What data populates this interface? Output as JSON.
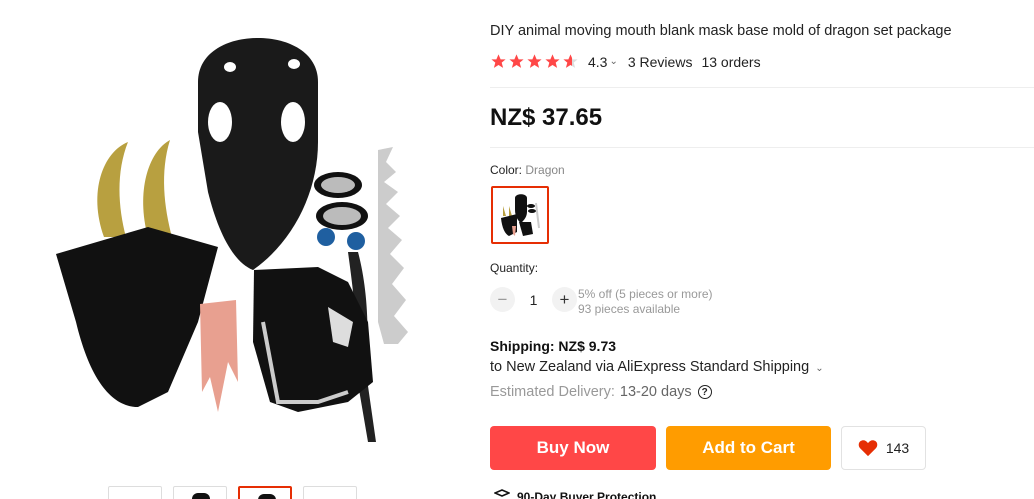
{
  "product": {
    "title": "DIY animal moving mouth blank mask base mold of dragon set package",
    "rating": "4.3",
    "reviews": "3 Reviews",
    "orders": "13 orders",
    "price": "NZ$ 37.65",
    "main_image_icon": "dragon-mask-kit-image"
  },
  "color": {
    "label": "Color:",
    "value": "Dragon"
  },
  "quantity": {
    "label": "Quantity:",
    "minus": "−",
    "value": "1",
    "plus": "+",
    "discount_note": "5% off (5 pieces or more)",
    "available_note": "93 pieces available"
  },
  "shipping": {
    "title": "Shipping: NZ$ 9.73",
    "via": "to New Zealand via AliExpress Standard Shipping",
    "delivery_label": "Estimated Delivery:",
    "delivery_days": "13-20 days",
    "help_glyph": "?"
  },
  "actions": {
    "buy_now": "Buy Now",
    "add_to_cart": "Add to Cart",
    "wishlist_count": "143"
  },
  "protection": {
    "label": "90-Day Buyer Protection"
  },
  "colors": {
    "star": "#ff4747",
    "buy": "#ff4747",
    "cart": "#ff9c00",
    "selected_border": "#e62e04"
  }
}
